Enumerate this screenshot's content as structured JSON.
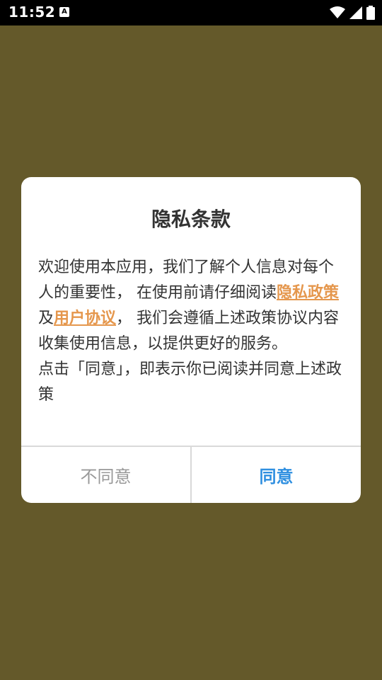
{
  "status_bar": {
    "time": "11:52",
    "notification_icon_letter": "A",
    "icons": [
      "wifi-icon",
      "signal-icon",
      "battery-icon"
    ]
  },
  "dialog": {
    "title": "隐私条款",
    "body_parts": {
      "intro": "欢迎使用本应用，我们了解个人信息对每个人的重要性， 在使用前请仔细阅读",
      "privacy_link": "隐私政策",
      "and": "及",
      "user_agreement_link": "用户协议",
      "after": "， 我们会遵循上述政策协议内容收集使用信息，以提供更好的服务。",
      "line2": "点击「同意」，即表示你已阅读并同意上述政策"
    },
    "disagree_label": "不同意",
    "agree_label": "同意"
  },
  "colors": {
    "background": "#64592a",
    "link": "#e5974d",
    "agree": "#2f8fe0",
    "disagree": "#999999"
  }
}
